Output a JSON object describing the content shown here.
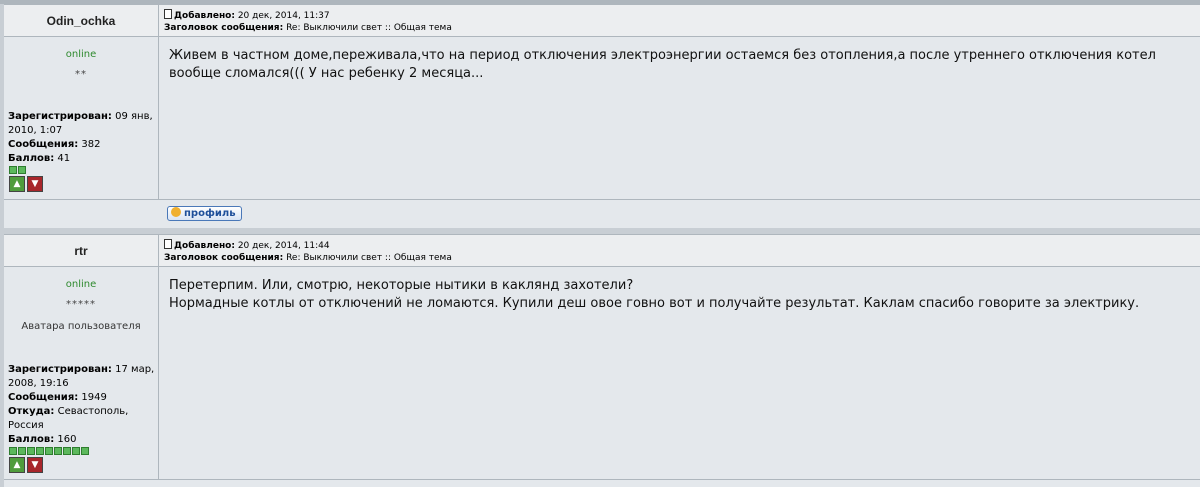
{
  "posts": [
    {
      "nick": "Odin_ochka",
      "added_label": "Добавлено:",
      "added_date": "20 дек, 2014, 11:37",
      "subject_label": "Заголовок сообщения:",
      "subject": "Re: Выключили свет :: Общая тема",
      "status": "online",
      "stars": "**",
      "registered_label": "Зарегистрирован:",
      "registered": "09 янв, 2010, 1:07",
      "messages_label": "Сообщения:",
      "messages": "382",
      "points_label": "Баллов:",
      "points": "41",
      "rating_dots": 2,
      "body_lines": [
        "Живем в частном доме,переживала,что на период отключения электроэнергии остаемся без отопления,а после утреннего отключения котел вообще сломался((( У нас ребенку 2 месяца..."
      ],
      "profile_button": "профиль"
    },
    {
      "nick": "rtr",
      "added_label": "Добавлено:",
      "added_date": "20 дек, 2014, 11:44",
      "subject_label": "Заголовок сообщения:",
      "subject": "Re: Выключили свет :: Общая тема",
      "status": "online",
      "stars": "*****",
      "avatar_text": "Аватара пользователя",
      "registered_label": "Зарегистрирован:",
      "registered": "17 мар, 2008, 19:16",
      "messages_label": "Сообщения:",
      "messages": "1949",
      "from_label": "Откуда:",
      "from": "Севастополь, Россия",
      "points_label": "Баллов:",
      "points": "160",
      "rating_dots": 9,
      "body_lines": [
        "Перетерпим. Или, смотрю, некоторые нытики в каклянд захотели?",
        "Нормадные котлы от отключений не ломаются. Купили деш овое говно вот и получайте результат. Каклам спасибо говорите за электрику."
      ]
    }
  ],
  "colors": {
    "online": "#2f8a2f",
    "background": "#c8ced4",
    "cell": "#e4e8ec",
    "header": "#eceef0"
  }
}
